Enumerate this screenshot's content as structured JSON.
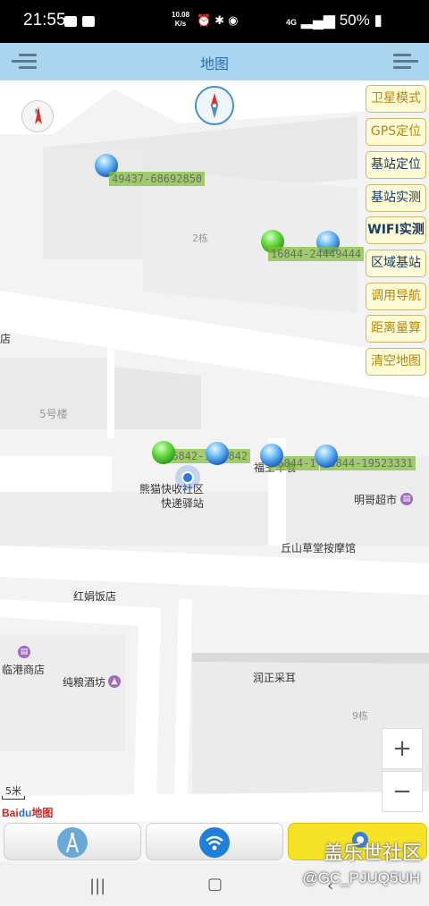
{
  "status_bar": {
    "time": "21:55",
    "speed_value": "10.08",
    "speed_unit": "K/s",
    "network": "4G",
    "battery": "50%"
  },
  "header": {
    "title": "地图",
    "left_icon": "menu-icon",
    "right_icon": "menu-icon"
  },
  "side_buttons": [
    {
      "label": "卫星模式"
    },
    {
      "label": "GPS定位"
    },
    {
      "label": "基站定位"
    },
    {
      "label": "基站实测"
    },
    {
      "label": "WIFI实测"
    },
    {
      "label": "区域基站"
    },
    {
      "label": "调用导航"
    },
    {
      "label": "距离量算"
    },
    {
      "label": "清空地图"
    }
  ],
  "cell_labels": [
    "49437-68692850",
    "16844-24449444",
    "16842-1",
    "16842",
    "16844-1",
    "16844-19523331"
  ],
  "map_labels": {
    "building_2": "2栋",
    "building_5": "5号楼",
    "building_9": "9栋",
    "store_left": "店",
    "panda_1": "熊猫快收社区",
    "panda_2": "快递驿站",
    "fujia": "福王早餐",
    "mingge": "明哥超市",
    "qiushan": "丘山草堂按摩馆",
    "hongjuan": "红娟饭店",
    "lingang": "临港商店",
    "chunliang": "纯粮酒坊",
    "runzheng": "润正采耳"
  },
  "map_controls": {
    "zoom_in": "+",
    "zoom_out": "−",
    "scale": "5米",
    "logo_bai": "Bai",
    "logo_du": "du",
    "logo_map": "地图"
  },
  "bottom_bar": {
    "icons": [
      "cell-tower-icon",
      "wifi-icon",
      "location-icon"
    ]
  },
  "watermark": {
    "line1": "盖乐世社区",
    "line2": "@GC_PJUQ5UH"
  },
  "colors": {
    "title_bar": "#a9d6ee",
    "side_button_text": "#b8860b",
    "cell_label_bg": "#82be3c"
  }
}
